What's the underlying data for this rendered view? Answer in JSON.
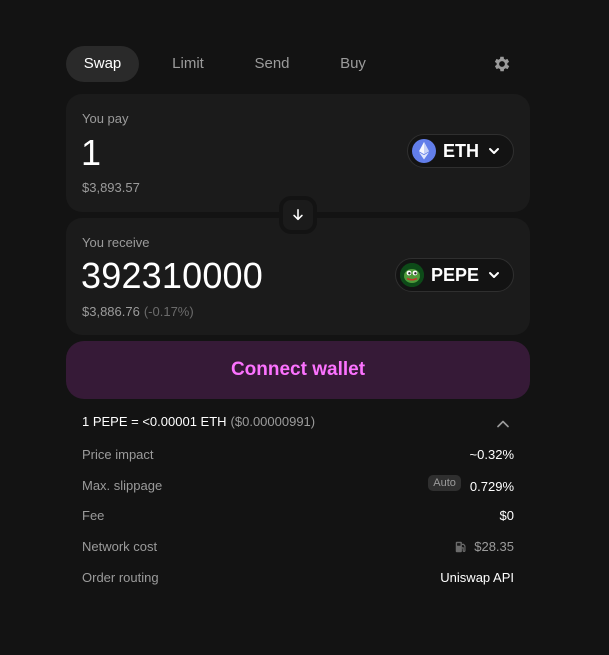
{
  "tabs": [
    {
      "label": "Swap",
      "active": true
    },
    {
      "label": "Limit",
      "active": false
    },
    {
      "label": "Send",
      "active": false
    },
    {
      "label": "Buy",
      "active": false
    }
  ],
  "pay": {
    "label": "You pay",
    "amount": "1",
    "usd": "$3,893.57",
    "token": "ETH",
    "token_icon": "eth-logo"
  },
  "receive": {
    "label": "You receive",
    "amount": "392310000",
    "usd": "$3,886.76",
    "pct": "(-0.17%)",
    "token": "PEPE",
    "token_icon": "pepe-logo"
  },
  "connect_label": "Connect wallet",
  "rate": {
    "text": "1 PEPE = <0.00001 ETH",
    "usd": "($0.00000991)"
  },
  "details": {
    "price_impact": {
      "label": "Price impact",
      "value": "~0.32%"
    },
    "slippage": {
      "label": "Max. slippage",
      "badge": "Auto",
      "value": "0.729%"
    },
    "fee": {
      "label": "Fee",
      "value": "$0"
    },
    "network_cost": {
      "label": "Network cost",
      "value": "$28.35"
    },
    "routing": {
      "label": "Order routing",
      "value": "Uniswap API"
    }
  },
  "colors": {
    "background": "#131313",
    "panel": "#1b1b1b",
    "accent": "#fc72ff",
    "connect_bg": "#361a37",
    "muted_text": "#9b9b9b"
  }
}
